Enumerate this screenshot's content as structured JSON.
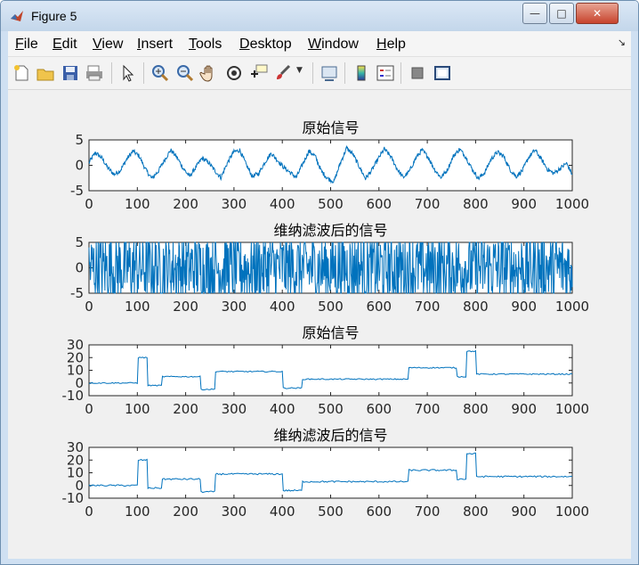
{
  "window": {
    "title": "Figure 5"
  },
  "menu": [
    "File",
    "Edit",
    "View",
    "Insert",
    "Tools",
    "Desktop",
    "Window",
    "Help"
  ],
  "toolbar_icons": [
    "new-figure-icon",
    "open-file-icon",
    "save-icon",
    "print-icon",
    "pointer-icon",
    "zoom-in-icon",
    "zoom-out-icon",
    "pan-icon",
    "rotate-3d-icon",
    "data-cursor-icon",
    "brush-icon",
    "dropdown-arrow-icon",
    "link-plot-icon",
    "colorbar-icon",
    "legend-icon",
    "hide-plot-tools-icon",
    "show-plot-tools-icon"
  ],
  "colors": {
    "line": "#0072bd",
    "axes_bg": "#ffffff",
    "figure_bg": "#f0f0f0"
  },
  "chart_data": [
    {
      "type": "line",
      "title": "原始信号",
      "xlim": [
        0,
        1000
      ],
      "ylim": [
        -5,
        5
      ],
      "xticks": [
        "0",
        "100",
        "200",
        "300",
        "400",
        "500",
        "600",
        "700",
        "800",
        "900",
        "1000"
      ],
      "yticks": [
        "5",
        "0",
        "-5"
      ],
      "description_values": "sinusoid-like signal, amplitude ~3, period ~52 samples, with small noise",
      "series": [
        {
          "x": [
            0,
            13,
            26,
            39,
            52,
            65,
            78,
            91,
            104,
            117,
            130,
            143,
            156,
            169,
            182,
            195,
            208,
            221,
            234,
            247,
            260,
            273,
            286,
            299,
            312,
            325,
            338,
            351,
            364,
            377,
            390,
            403,
            416,
            429,
            442,
            455,
            468,
            481,
            494,
            507,
            520,
            533,
            546,
            559,
            572,
            585,
            598,
            611,
            624,
            637,
            650,
            663,
            676,
            689,
            702,
            715,
            728,
            741,
            754,
            767,
            780,
            793,
            806,
            819,
            832,
            845,
            858,
            871,
            884,
            897,
            910,
            923,
            936,
            949,
            962,
            975,
            988,
            1000
          ],
          "y": [
            0.5,
            2.5,
            1.5,
            -0.5,
            -1.8,
            -1.0,
            1.2,
            2.8,
            1.8,
            -0.8,
            -2.6,
            -1.2,
            1.0,
            3.0,
            1.6,
            -0.6,
            -2.2,
            -0.4,
            1.4,
            0.6,
            -1.0,
            -2.4,
            0.4,
            2.6,
            3.0,
            0.2,
            -2.2,
            -1.6,
            0.6,
            2.4,
            1.0,
            -0.4,
            -1.4,
            -2.4,
            0.2,
            2.8,
            1.8,
            -1.2,
            -2.6,
            -3.2,
            0.4,
            3.4,
            2.2,
            -0.2,
            -2.6,
            -1.0,
            1.2,
            3.2,
            1.8,
            -0.6,
            -2.4,
            -1.2,
            1.4,
            3.0,
            1.6,
            -0.8,
            -2.4,
            -1.0,
            1.8,
            3.2,
            1.6,
            -0.8,
            -2.6,
            -1.4,
            1.2,
            2.6,
            1.8,
            -0.8,
            -2.2,
            -1.0,
            1.6,
            3.0,
            1.2,
            -0.8,
            -1.6,
            -0.6,
            0.4,
            -1.8
          ]
        }
      ]
    },
    {
      "type": "line",
      "title": "维纳滤波后的信号",
      "xlim": [
        0,
        1000
      ],
      "ylim": [
        -5,
        5
      ],
      "xticks": [
        "0",
        "100",
        "200",
        "300",
        "400",
        "500",
        "600",
        "700",
        "800",
        "900",
        "1000"
      ],
      "yticks": [
        "5",
        "0",
        "-5"
      ],
      "description_values": "dense noisy signal clipped within ±5",
      "series": [
        {
          "x": [
            0,
            1000
          ],
          "y": [
            0,
            0
          ]
        }
      ]
    },
    {
      "type": "line",
      "title": "原始信号",
      "xlim": [
        0,
        1000
      ],
      "ylim": [
        -10,
        30
      ],
      "xticks": [
        "0",
        "100",
        "200",
        "300",
        "400",
        "500",
        "600",
        "700",
        "800",
        "900",
        "1000"
      ],
      "yticks": [
        "30",
        "20",
        "10",
        "0",
        "-10"
      ],
      "series": [
        {
          "x": [
            0,
            100,
            102,
            102,
            120,
            122,
            122,
            150,
            152,
            152,
            230,
            232,
            232,
            260,
            262,
            262,
            400,
            402,
            402,
            440,
            442,
            442,
            660,
            662,
            662,
            760,
            762,
            762,
            780,
            782,
            782,
            800,
            802,
            802,
            1000
          ],
          "y": [
            0,
            0,
            0,
            20,
            20,
            20,
            -2,
            -2,
            -2,
            5,
            5,
            5,
            -5,
            -5,
            -5,
            9,
            9,
            9,
            -4,
            -4,
            -4,
            3,
            3,
            3,
            12,
            12,
            12,
            5,
            5,
            5,
            25,
            25,
            25,
            7,
            7
          ]
        }
      ]
    },
    {
      "type": "line",
      "title": "维纳滤波后的信号",
      "xlim": [
        0,
        1000
      ],
      "ylim": [
        -10,
        30
      ],
      "xticks": [
        "0",
        "100",
        "200",
        "300",
        "400",
        "500",
        "600",
        "700",
        "800",
        "900",
        "1000"
      ],
      "yticks": [
        "30",
        "20",
        "10",
        "0",
        "-10"
      ],
      "series": [
        {
          "x": [
            0,
            100,
            102,
            102,
            120,
            122,
            122,
            150,
            152,
            152,
            230,
            232,
            232,
            260,
            262,
            262,
            400,
            402,
            402,
            440,
            442,
            442,
            660,
            662,
            662,
            760,
            762,
            762,
            780,
            782,
            782,
            800,
            802,
            802,
            1000
          ],
          "y": [
            0,
            0,
            0,
            20,
            20,
            20,
            -2,
            -2,
            -2,
            5,
            5,
            5,
            -5,
            -5,
            -5,
            9,
            9,
            9,
            -4,
            -4,
            -4,
            3,
            3,
            3,
            12,
            12,
            12,
            5,
            5,
            5,
            25,
            25,
            25,
            7,
            7
          ]
        }
      ]
    }
  ]
}
